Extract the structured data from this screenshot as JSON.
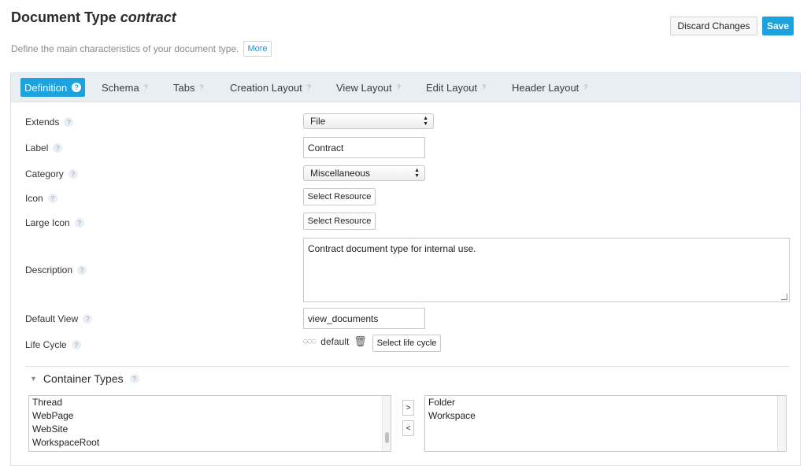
{
  "header": {
    "title_prefix": "Document Type ",
    "title_name": "contract",
    "subtitle": "Define the main characteristics of your document type.",
    "more_label": "More",
    "discard_label": "Discard Changes",
    "save_label": "Save"
  },
  "tabs": [
    {
      "label": "Definition",
      "active": true
    },
    {
      "label": "Schema"
    },
    {
      "label": "Tabs"
    },
    {
      "label": "Creation Layout"
    },
    {
      "label": "View Layout"
    },
    {
      "label": "Edit Layout"
    },
    {
      "label": "Header Layout"
    }
  ],
  "form": {
    "extends_label": "Extends",
    "extends_value": "File",
    "label_label": "Label",
    "label_value": "Contract",
    "category_label": "Category",
    "category_value": "Miscellaneous",
    "icon_label": "Icon",
    "large_icon_label": "Large Icon",
    "select_resource": "Select Resource",
    "description_label": "Description",
    "description_value": "Contract document type for internal use.",
    "default_view_label": "Default View",
    "default_view_value": "view_documents",
    "life_cycle_label": "Life Cycle",
    "life_cycle_value": "default",
    "select_life_cycle": "Select life cycle"
  },
  "container_types": {
    "heading": "Container Types",
    "available": [
      "Thread",
      "WebPage",
      "WebSite",
      "WorkspaceRoot"
    ],
    "selected": [
      "Folder",
      "Workspace"
    ],
    "add_label": ">",
    "remove_label": "<"
  },
  "help_glyph": "?"
}
